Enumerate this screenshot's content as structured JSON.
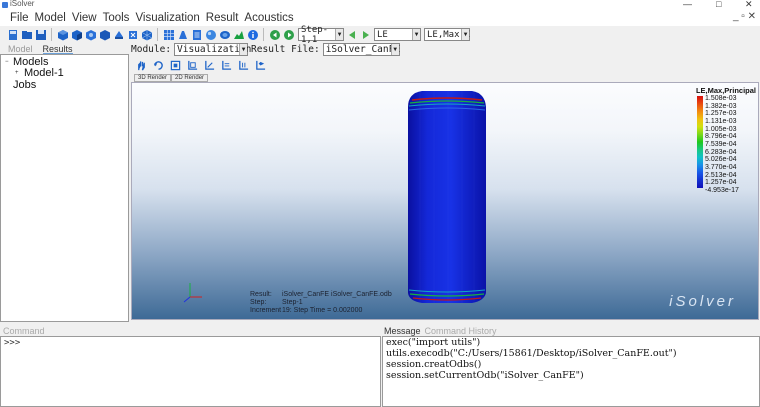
{
  "window": {
    "title": "iSolver",
    "controls": [
      "—",
      "□",
      "✕"
    ]
  },
  "menu": {
    "items": [
      "File",
      "Model",
      "View",
      "Tools",
      "Visualization",
      "Result",
      "Acoustics"
    ],
    "window_controls": "_ ▫ ✕"
  },
  "toolbar": {
    "step_combo": "Step-1,1",
    "variable_combo": "LE",
    "component_combo": "LE,Max,I"
  },
  "left_panel": {
    "tabs": [
      "Model",
      "Results"
    ],
    "tree": {
      "root": "Models",
      "child": "Model-1",
      "jobs": "Jobs"
    }
  },
  "module_row": {
    "module_label": "Module:",
    "module_value": "Visualization",
    "result_file_label": "Result File:",
    "result_file_value": "iSolver_CanFE"
  },
  "viewport_tabs": [
    "3D Render",
    "2D Render"
  ],
  "viewport": {
    "brand": "iSolver",
    "info": {
      "result_key": "Result:",
      "result_val": "iSolver_CanFE      iSolver_CanFE.odb",
      "step_key": "Step:",
      "step_val": "Step-1",
      "increment_key": "Increment",
      "increment_val": "19: Step Time = 0.002000"
    }
  },
  "legend": {
    "title": "LE,Max,Principal",
    "values": [
      "1.508e-03",
      "1.382e-03",
      "1.257e-03",
      "1.131e-03",
      "1.005e-03",
      "8.796e-04",
      "7.539e-04",
      "6.283e-04",
      "5.026e-04",
      "3.770e-04",
      "2.513e-04",
      "1.257e-04",
      "-4.953e-17"
    ],
    "colors": [
      "#d81010",
      "#e94a10",
      "#f28a10",
      "#f0c010",
      "#d0e010",
      "#7ad81a",
      "#1ec81e",
      "#18c880",
      "#10c0c8",
      "#1890e8",
      "#1858e8",
      "#1430d0",
      "#1010b8"
    ]
  },
  "command": {
    "title": "Command",
    "prompt": ">>>"
  },
  "history": {
    "tabs": [
      "Message",
      "Command History"
    ],
    "lines": [
      "exec(\"import utils\")",
      "utils.execodb(\"C:/Users/15861/Desktop/iSolver_CanFE.out\")",
      "session.creatOdbs()",
      "session.setCurrentOdb(\"iSolver_CanFE\")"
    ]
  }
}
